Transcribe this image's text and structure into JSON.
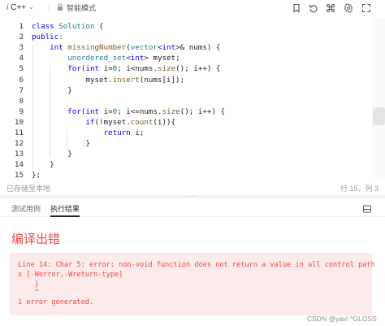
{
  "toolbar": {
    "language": "C++",
    "mode_label": "智能模式",
    "icons": [
      "code-lang-icon",
      "chevron-down-icon",
      "lock-icon",
      "bookmark-icon",
      "reset-icon",
      "command-icon",
      "settings-icon",
      "fullscreen-icon"
    ]
  },
  "editor": {
    "lines": [
      {
        "n": "1",
        "html": "<span class=\"kw\">class</span> <span class=\"ty\">Solution</span> <span class=\"pu\">{</span>"
      },
      {
        "n": "2",
        "html": "<span class=\"kw\">public</span><span class=\"pu\">:</span>"
      },
      {
        "n": "3",
        "html": "    <span class=\"kw\">int</span> <span class=\"fn\">missingNumber</span>(<span class=\"ty\">vector</span>&lt;<span class=\"kw\">int</span>&gt;&amp; nums) {"
      },
      {
        "n": "4",
        "html": "        <span class=\"ty\">unordered_set</span>&lt;<span class=\"kw\">int</span>&gt; myset;"
      },
      {
        "n": "5",
        "html": "        <span class=\"kw\">for</span>(<span class=\"kw\">int</span> i=<span class=\"num\">0</span>; i&lt;nums.<span class=\"fn\">size</span>(); i++) {"
      },
      {
        "n": "6",
        "html": "            myset.<span class=\"fn\">insert</span>(nums[i]);"
      },
      {
        "n": "7",
        "html": "        }"
      },
      {
        "n": "8",
        "html": ""
      },
      {
        "n": "9",
        "html": "        <span class=\"kw\">for</span>(<span class=\"kw\">int</span> i=<span class=\"num\">0</span>; i&lt;=nums.<span class=\"fn\">size</span>(); i++) {"
      },
      {
        "n": "10",
        "html": "            <span class=\"kw\">if</span>(!myset.<span class=\"fn\">count</span>(i)){"
      },
      {
        "n": "11",
        "html": "                <span class=\"kw\">return</span> i;"
      },
      {
        "n": "12",
        "html": "            }"
      },
      {
        "n": "13",
        "html": "        }"
      },
      {
        "n": "14",
        "html": "    }"
      },
      {
        "n": "15",
        "html": "};"
      }
    ]
  },
  "status": {
    "saved": "已存储至本地",
    "cursor": "行 15，列 3"
  },
  "tabs": [
    {
      "label": "测试用例",
      "active": false
    },
    {
      "label": "执行结果",
      "active": true
    }
  ],
  "result": {
    "title": "编译出错",
    "error_lines": [
      "Line 14: Char 5: error: non-void function does not return a value in all control path",
      "s [-Werror,-Wreturn-type]",
      "    }",
      "    ^",
      "1 error generated."
    ]
  },
  "watermark": "CSDN @yavl ^GLOSS",
  "colors": {
    "error_red": "#ef4743",
    "error_bg": "#fcebeb",
    "keyword_blue": "#0000ff",
    "type_teal": "#267f99"
  }
}
